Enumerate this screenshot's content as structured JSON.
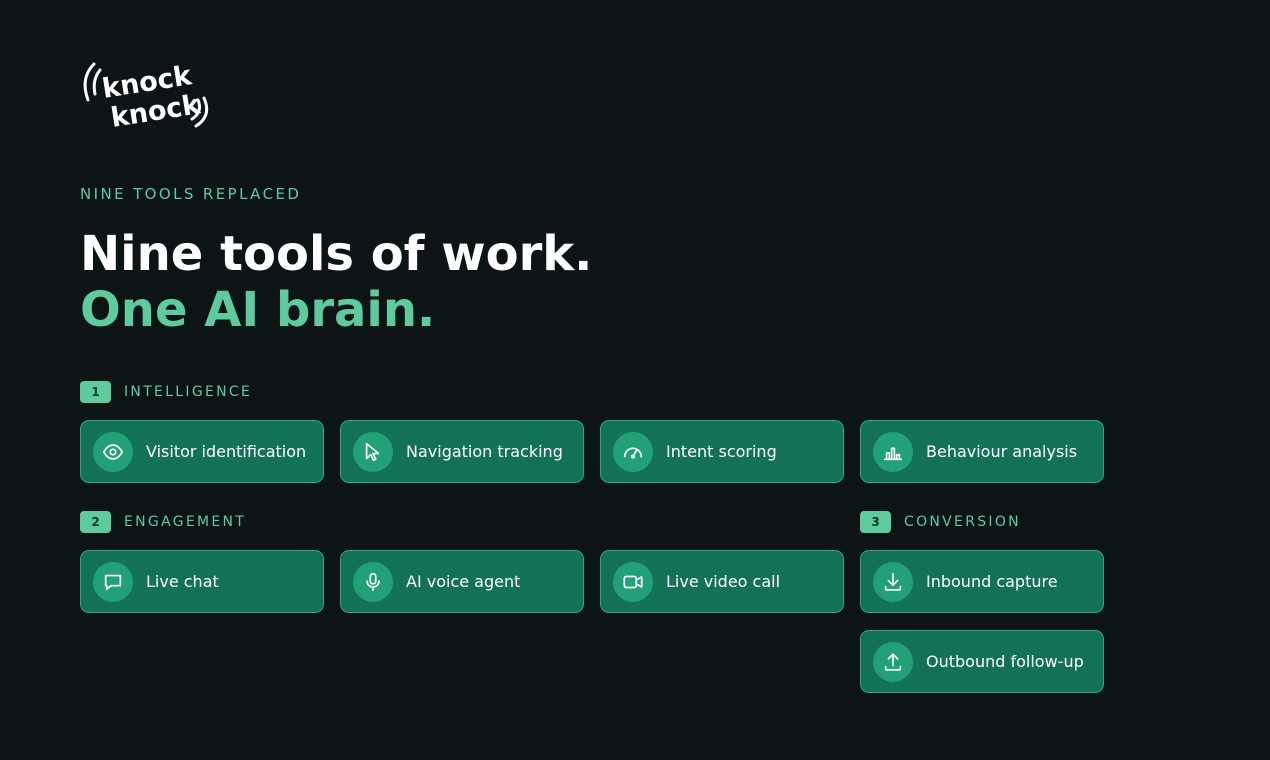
{
  "brand": {
    "logo_line1": "knock",
    "logo_line2": "knock"
  },
  "eyebrow": "NINE TOOLS REPLACED",
  "headline": {
    "line1": "Nine tools of work.",
    "line2": "One AI brain."
  },
  "sections": [
    {
      "number": "1",
      "name": "INTELLIGENCE",
      "tools": [
        {
          "label": "Visitor identification",
          "icon": "eye-icon"
        },
        {
          "label": "Navigation tracking",
          "icon": "cursor-icon"
        },
        {
          "label": "Intent scoring",
          "icon": "gauge-icon"
        },
        {
          "label": "Behaviour analysis",
          "icon": "bar-chart-icon"
        }
      ]
    },
    {
      "number": "2",
      "name": "ENGAGEMENT",
      "tools": [
        {
          "label": "Live chat",
          "icon": "chat-bubble-icon"
        },
        {
          "label": "AI voice agent",
          "icon": "microphone-icon"
        },
        {
          "label": "Live video call",
          "icon": "video-camera-icon"
        }
      ]
    },
    {
      "number": "3",
      "name": "CONVERSION",
      "tools": [
        {
          "label": "Inbound capture",
          "icon": "download-icon"
        },
        {
          "label": "Outbound follow-up",
          "icon": "upload-icon"
        }
      ]
    }
  ],
  "colors": {
    "background": "#0c1416",
    "accent": "#5ecb9f",
    "card": "#137255",
    "card_border": "#2ea77c",
    "icon_circle": "#22a178"
  }
}
